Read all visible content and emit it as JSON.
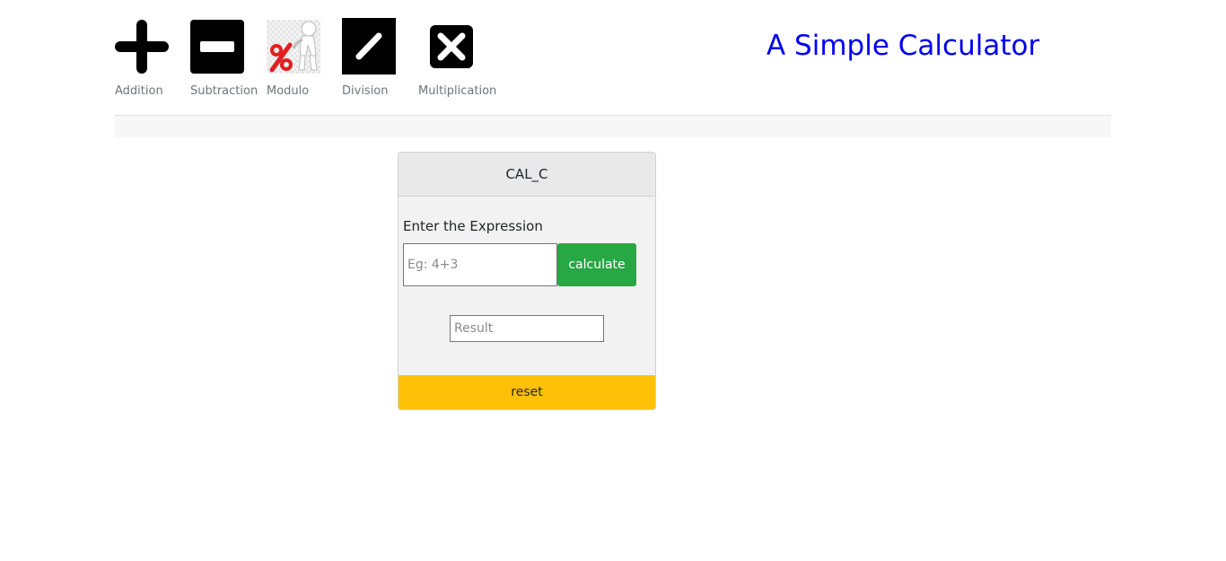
{
  "toolbar": {
    "operations": [
      {
        "id": "addition",
        "label": "Addition",
        "icon": "plus-icon"
      },
      {
        "id": "subtraction",
        "label": "Subtraction",
        "icon": "minus-icon"
      },
      {
        "id": "modulo",
        "label": "Modulo",
        "icon": "percent-figure-icon"
      },
      {
        "id": "division",
        "label": "Division",
        "icon": "slash-icon"
      },
      {
        "id": "multiplication",
        "label": "Multiplication",
        "icon": "times-icon"
      }
    ]
  },
  "header": {
    "title": "A Simple Calculator",
    "title_color": "#0000ee"
  },
  "calculator": {
    "card_title": "CAL_C",
    "expression_label": "Enter the Expression",
    "expression_value": "",
    "expression_placeholder": "Eg: 4+3",
    "calculate_label": "calculate",
    "result_value": "",
    "result_placeholder": "Result",
    "reset_label": "reset"
  },
  "colors": {
    "calculate_button": "#28a745",
    "reset_button": "#ffc107",
    "card_background": "#f2f2f2",
    "card_header": "#e9e9e9"
  }
}
